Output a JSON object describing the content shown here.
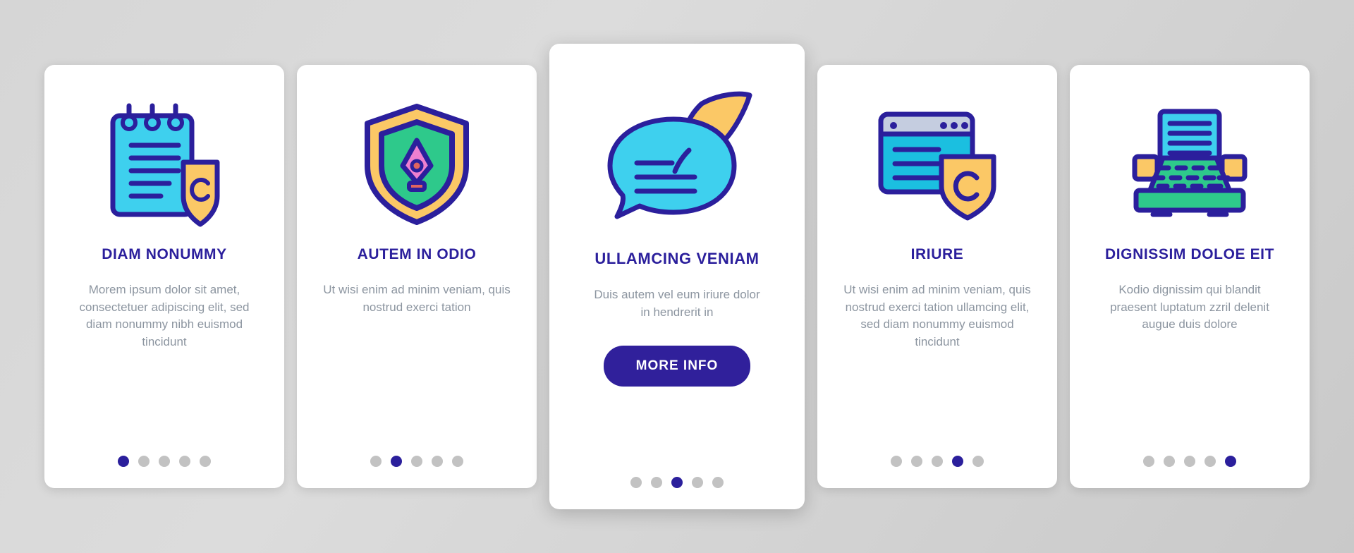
{
  "theme": {
    "background": "#d6d6d6",
    "card_bg": "#ffffff",
    "title_color": "#2b1f9c",
    "desc_color": "#8c95a0",
    "accent": "#30209b",
    "dot_inactive": "#c2c2c2",
    "dot_active": "#2b1f9c",
    "cyan": "#3ed0ee",
    "green": "#2ec98b",
    "yellow": "#fbc866",
    "pink": "#ef7fd0",
    "outline": "#2b1f9c"
  },
  "cards": [
    {
      "icon": "notepad-shield-copyright-icon",
      "title": "DIAM NONUMMY",
      "description": "Morem ipsum dolor sit amet, consectetuer adipiscing elit, sed diam nonummy nibh euismod tincidunt",
      "featured": false,
      "cta": null,
      "dots": {
        "count": 5,
        "active_index": 0
      }
    },
    {
      "icon": "shield-pen-nib-icon",
      "title": "AUTEM IN ODIO",
      "description": "Ut wisi enim ad minim veniam, quis nostrud exerci tation",
      "featured": false,
      "cta": null,
      "dots": {
        "count": 5,
        "active_index": 1
      }
    },
    {
      "icon": "speech-bubble-feather-quill-icon",
      "title": "ULLAMCING VENIAM",
      "description": "Duis autem vel eum iriure dolor in hendrerit in",
      "featured": true,
      "cta": "MORE INFO",
      "dots": {
        "count": 5,
        "active_index": 2
      }
    },
    {
      "icon": "browser-window-shield-copyright-icon",
      "title": "IRIURE",
      "description": "Ut wisi enim ad minim veniam, quis nostrud exerci tation ullamcing elit, sed diam nonummy euismod tincidunt",
      "featured": false,
      "cta": null,
      "dots": {
        "count": 5,
        "active_index": 3
      }
    },
    {
      "icon": "typewriter-icon",
      "title": "DIGNISSIM DOLOE EIT",
      "description": "Kodio dignissim qui blandit praesent luptatum zzril delenit augue duis dolore",
      "featured": false,
      "cta": null,
      "dots": {
        "count": 5,
        "active_index": 4
      }
    }
  ]
}
